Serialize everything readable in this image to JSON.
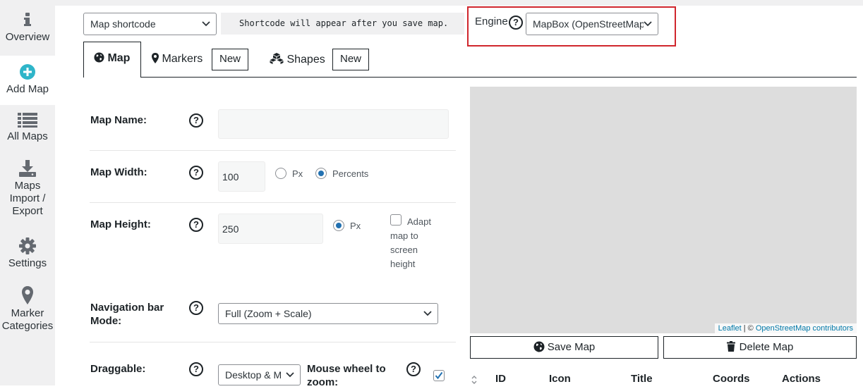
{
  "sidebar": {
    "items": [
      {
        "label": "Overview",
        "icon": "info-icon"
      },
      {
        "label": "Add Map",
        "icon": "plus-circle-icon"
      },
      {
        "label": "All Maps",
        "icon": "list-icon"
      },
      {
        "label": "Maps Import / Export",
        "icon": "download-icon"
      },
      {
        "label": "Settings",
        "icon": "gear-icon"
      },
      {
        "label": "Marker Categories",
        "icon": "map-pin-icon"
      }
    ],
    "active_index": 1,
    "accent_color": "#2fb5c9"
  },
  "header": {
    "shortcode_select": "Map shortcode",
    "shortcode_note": "Shortcode will appear after you save map.",
    "engine_label": "Engine",
    "engine_value": "MapBox (OpenStreetMap",
    "highlight_color": "#d0262d"
  },
  "tabs": {
    "map": "Map",
    "markers": "Markers",
    "markers_new": "New",
    "shapes": "Shapes",
    "shapes_new": "New",
    "help": "?"
  },
  "form": {
    "map_name_label": "Map Name:",
    "map_name_value": "",
    "map_width_label": "Map Width:",
    "map_width_value": "100",
    "width_unit_px": "Px",
    "width_unit_percents": "Percents",
    "width_unit_selected": "Percents",
    "map_height_label": "Map Height:",
    "map_height_value": "250",
    "height_unit_px": "Px",
    "adapt_label": "Adapt map to screen height",
    "adapt_checked": false,
    "nav_bar_label": "Navigation bar Mode:",
    "nav_bar_value": "Full (Zoom + Scale)",
    "draggable_label": "Draggable:",
    "draggable_value": "Desktop & M",
    "mouse_wheel_label": "Mouse wheel to zoom:",
    "mouse_wheel_checked": true
  },
  "map_preview": {
    "attribution_leaflet": "Leaflet",
    "attribution_sep": " | © ",
    "attribution_osm": "OpenStreetMap contributors"
  },
  "actions": {
    "save": "Save Map",
    "delete": "Delete Map"
  },
  "markers_table": {
    "columns": [
      "ID",
      "Icon",
      "Title",
      "Coords",
      "Actions"
    ]
  }
}
